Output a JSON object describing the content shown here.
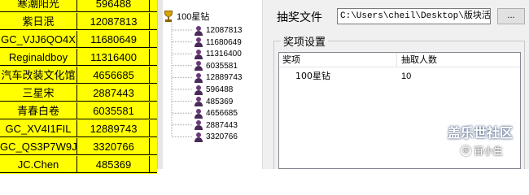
{
  "spreadsheet": {
    "rows": [
      {
        "name": "寒潮阳光",
        "score": "596488"
      },
      {
        "name": "紫日泯",
        "score": "12087813"
      },
      {
        "name": "GC_VJJ6QO4X",
        "score": "11680649"
      },
      {
        "name": "Reginaldboy",
        "score": "11316400"
      },
      {
        "name": "汽车改装文化馆",
        "score": "4656685"
      },
      {
        "name": "三星宋",
        "score": "2887443"
      },
      {
        "name": "青春白卷",
        "score": "6035581"
      },
      {
        "name": "GC_XV4I1FIL",
        "score": "12889743"
      },
      {
        "name": "GC_QS3P7W9J",
        "score": "3320766"
      },
      {
        "name": "JC.Chen",
        "score": "485369"
      }
    ]
  },
  "tree": {
    "root_label": "100星钻",
    "items": [
      "12087813",
      "11680649",
      "11316400",
      "6035581",
      "12889743",
      "596488",
      "485369",
      "4656685",
      "2887443",
      "3320766"
    ]
  },
  "panel": {
    "file_label": "抽奖文件",
    "file_path": "C:\\Users\\cheil\\Desktop\\版块活",
    "browse_label": "...",
    "group_title": "奖项设置",
    "columns": [
      "奖项",
      "抽取人数"
    ],
    "rows": [
      {
        "prize": "100星钻",
        "count": "10"
      }
    ]
  },
  "watermark": {
    "title": "盖乐世社区",
    "at": "@",
    "subtitle": "百小生"
  },
  "colors": {
    "sheet_bg": "#ffff00",
    "panel_bg": "#f0f0f0"
  }
}
